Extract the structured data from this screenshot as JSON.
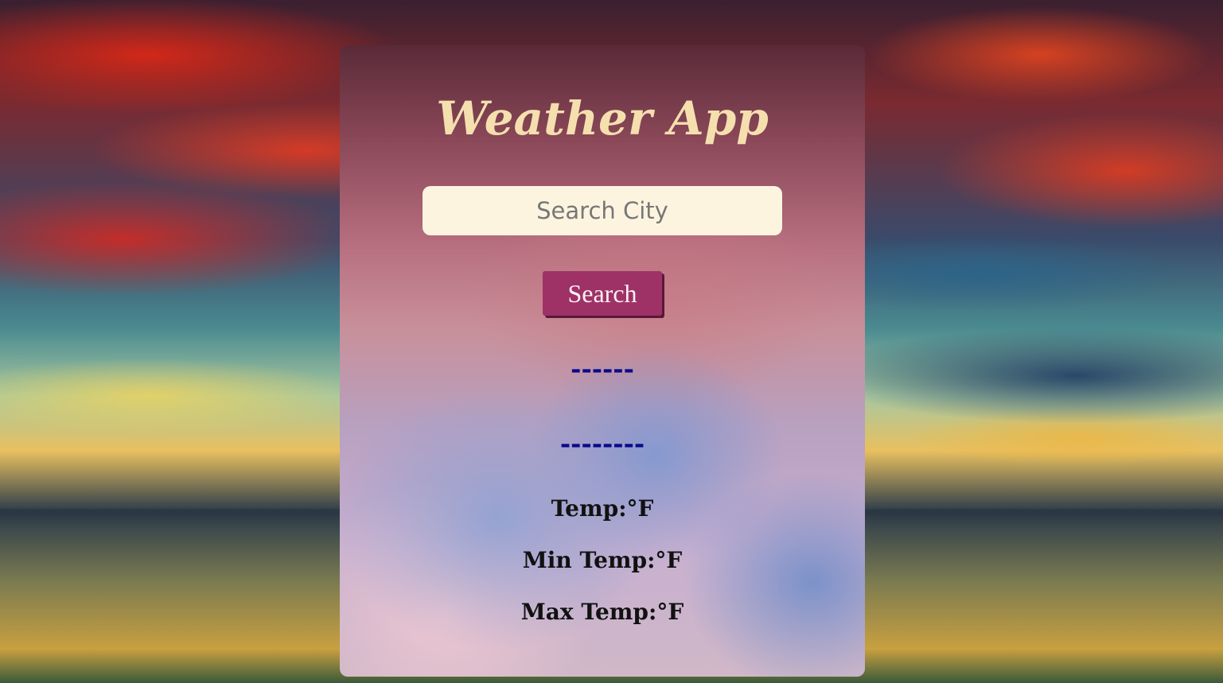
{
  "app": {
    "title": "Weather App"
  },
  "search": {
    "placeholder": "Search City",
    "value": "",
    "button_label": "Search"
  },
  "weather": {
    "city": "------",
    "description": "--------",
    "temp": "Temp:°F",
    "min_temp": "Min Temp:°F",
    "max_temp": "Max Temp:°F"
  },
  "colors": {
    "title": "#f5dfae",
    "input_bg": "#fdf4e0",
    "button_bg": "#9e3266",
    "placeholder_lines": "#0a0a8a"
  }
}
